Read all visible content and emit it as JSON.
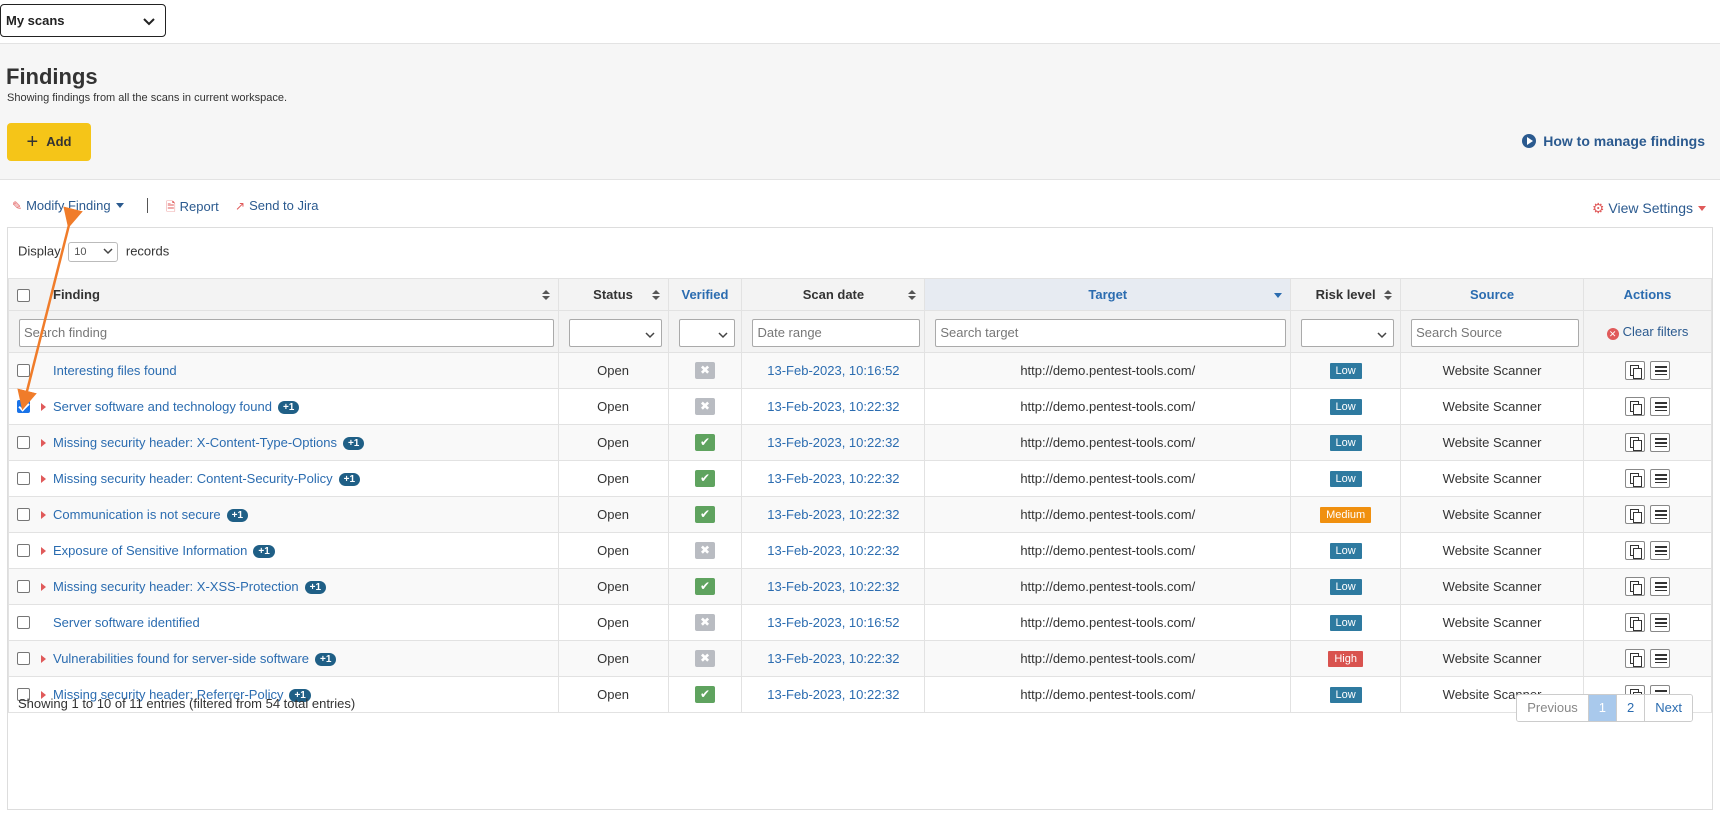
{
  "topbar": {
    "scan_select": "My scans"
  },
  "header": {
    "title": "Findings",
    "subtitle": "Showing findings from all the scans in current workspace.",
    "add_label": "Add",
    "how_link": "How to manage findings"
  },
  "toolbar": {
    "modify": "Modify Finding",
    "report": "Report",
    "send_jira": "Send to Jira",
    "view_settings": "View Settings"
  },
  "display": {
    "prefix": "Display",
    "value": "10",
    "suffix": "records"
  },
  "columns": {
    "finding": "Finding",
    "status": "Status",
    "verified": "Verified",
    "scan_date": "Scan date",
    "target": "Target",
    "risk": "Risk level",
    "source": "Source",
    "actions": "Actions"
  },
  "filters": {
    "finding_placeholder": "Search finding",
    "date_placeholder": "Date range",
    "target_placeholder": "Search target",
    "source_placeholder": "Search Source",
    "clear": "Clear filters"
  },
  "rows": [
    {
      "checked": false,
      "expandable": false,
      "name": "Interesting files found",
      "badge": "",
      "status": "Open",
      "verified": false,
      "date": "13-Feb-2023, 10:16:52",
      "target": "http://demo.pentest-tools.com/",
      "risk": "Low",
      "source": "Website Scanner"
    },
    {
      "checked": true,
      "expandable": true,
      "name": "Server software and technology found",
      "badge": "+1",
      "status": "Open",
      "verified": false,
      "date": "13-Feb-2023, 10:22:32",
      "target": "http://demo.pentest-tools.com/",
      "risk": "Low",
      "source": "Website Scanner"
    },
    {
      "checked": false,
      "expandable": true,
      "name": "Missing security header: X-Content-Type-Options",
      "badge": "+1",
      "status": "Open",
      "verified": true,
      "date": "13-Feb-2023, 10:22:32",
      "target": "http://demo.pentest-tools.com/",
      "risk": "Low",
      "source": "Website Scanner"
    },
    {
      "checked": false,
      "expandable": true,
      "name": "Missing security header: Content-Security-Policy",
      "badge": "+1",
      "status": "Open",
      "verified": true,
      "date": "13-Feb-2023, 10:22:32",
      "target": "http://demo.pentest-tools.com/",
      "risk": "Low",
      "source": "Website Scanner"
    },
    {
      "checked": false,
      "expandable": true,
      "name": "Communication is not secure",
      "badge": "+1",
      "status": "Open",
      "verified": true,
      "date": "13-Feb-2023, 10:22:32",
      "target": "http://demo.pentest-tools.com/",
      "risk": "Medium",
      "source": "Website Scanner"
    },
    {
      "checked": false,
      "expandable": true,
      "name": "Exposure of Sensitive Information",
      "badge": "+1",
      "status": "Open",
      "verified": false,
      "date": "13-Feb-2023, 10:22:32",
      "target": "http://demo.pentest-tools.com/",
      "risk": "Low",
      "source": "Website Scanner"
    },
    {
      "checked": false,
      "expandable": true,
      "name": "Missing security header: X-XSS-Protection",
      "badge": "+1",
      "status": "Open",
      "verified": true,
      "date": "13-Feb-2023, 10:22:32",
      "target": "http://demo.pentest-tools.com/",
      "risk": "Low",
      "source": "Website Scanner"
    },
    {
      "checked": false,
      "expandable": false,
      "name": "Server software identified",
      "badge": "",
      "status": "Open",
      "verified": false,
      "date": "13-Feb-2023, 10:16:52",
      "target": "http://demo.pentest-tools.com/",
      "risk": "Low",
      "source": "Website Scanner"
    },
    {
      "checked": false,
      "expandable": true,
      "name": "Vulnerabilities found for server-side software",
      "badge": "+1",
      "status": "Open",
      "verified": false,
      "date": "13-Feb-2023, 10:22:32",
      "target": "http://demo.pentest-tools.com/",
      "risk": "High",
      "source": "Website Scanner"
    },
    {
      "checked": false,
      "expandable": true,
      "name": "Missing security header: Referrer-Policy",
      "badge": "+1",
      "status": "Open",
      "verified": true,
      "date": "13-Feb-2023, 10:22:32",
      "target": "http://demo.pentest-tools.com/",
      "risk": "Low",
      "source": "Website Scanner"
    }
  ],
  "risk_colors": {
    "Low": "#2e7aa0",
    "Medium": "#f0900f",
    "High": "#d9534f"
  },
  "footer": {
    "info": "Showing 1 to 10 of 11 entries (filtered from 54 total entries)",
    "prev": "Previous",
    "page1": "1",
    "page2": "2",
    "next": "Next"
  },
  "colors": {
    "accent": "#2b6cb0",
    "add_button": "#f5c518",
    "annotation": "#f07c2a"
  }
}
